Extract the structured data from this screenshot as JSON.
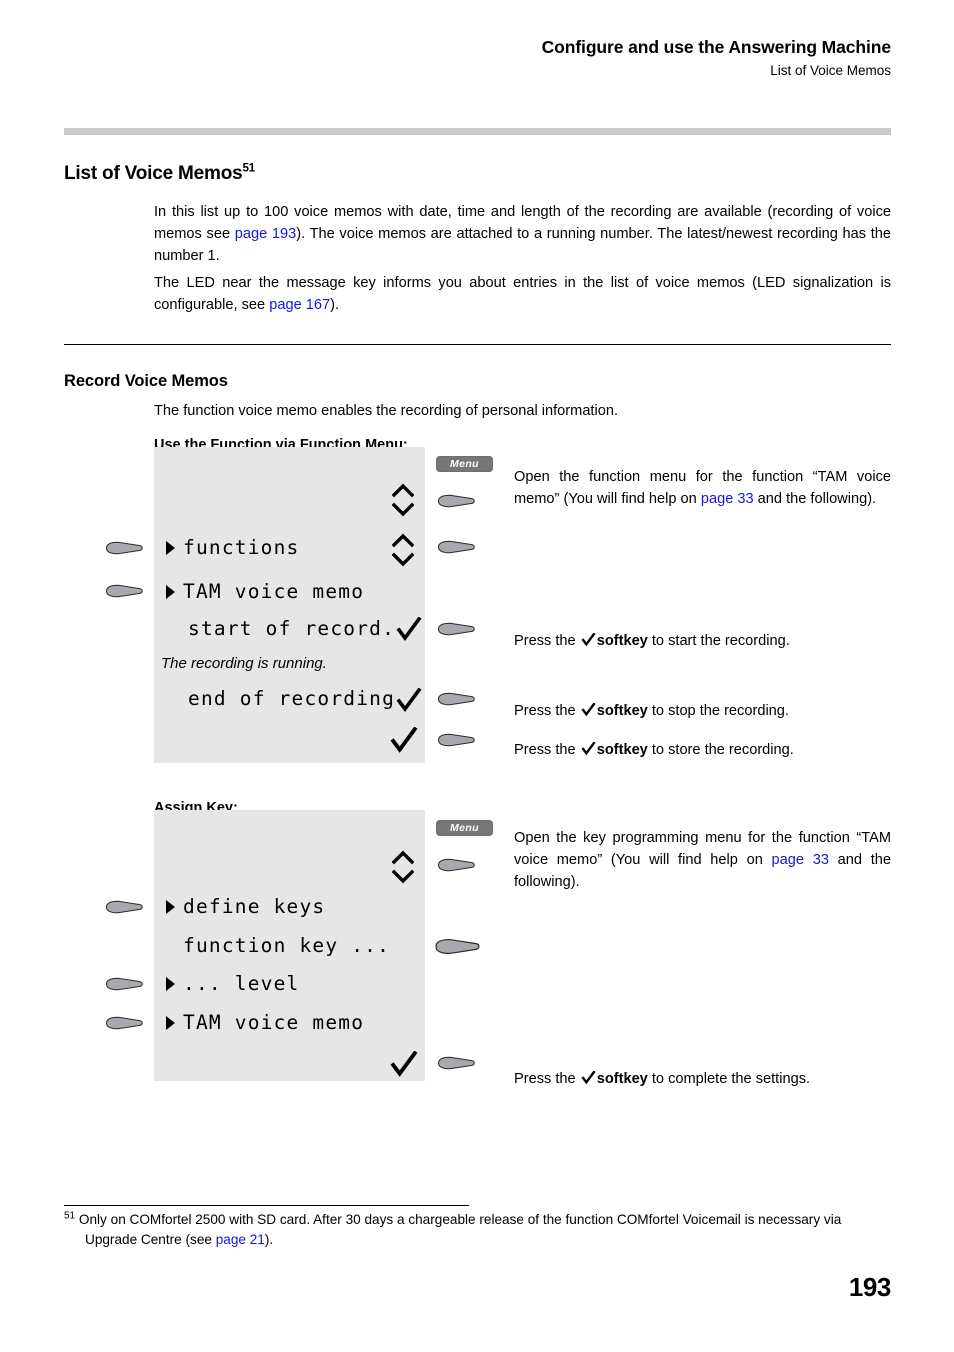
{
  "header": {
    "title": "Configure and use the Answering Machine",
    "subtitle": "List of Voice Memos"
  },
  "sections": {
    "list_of_voice_memos": {
      "heading": "List of Voice Memos",
      "heading_footnote_marker": "51",
      "paragraph_1_a": "In this list up to 100 voice memos with date, time and length of the recording are available (recording of voice memos see ",
      "paragraph_1_link": "page 193",
      "paragraph_1_b": "). The voice memos are attached to a running number. The latest/newest recording has the number 1.",
      "paragraph_2_a": "The LED near the message key informs you about entries in the list of voice memos (LED signalization is configurable, see ",
      "paragraph_2_link": "page 167",
      "paragraph_2_b": ")."
    },
    "record_voice_memos": {
      "heading": "Record Voice Memos",
      "intro": "The function voice memo enables the recording of personal information.",
      "subheading_function_menu": "Use the Function via Function Menu:",
      "subheading_assign_key": "Assign Key:"
    }
  },
  "diagram_function_menu": {
    "menu_key_label": "Menu",
    "lcd_lines": [
      "functions",
      "TAM voice memo",
      "start of record.",
      "end of recording"
    ],
    "lcd_status_italic": "The recording is running.",
    "instructions": [
      {
        "text_a": "Open the function menu for the function “TAM voice memo” (You will find help on ",
        "link": "page 33",
        "text_b": " and the following)."
      },
      {
        "text_a": "Press the ",
        "bold": "softkey",
        "text_b": " to start the recording."
      },
      {
        "text_a": "Press the ",
        "bold": "softkey",
        "text_b": " to stop the recording."
      },
      {
        "text_a": "Press the ",
        "bold": "softkey",
        "text_b": " to store the recording."
      }
    ]
  },
  "diagram_assign_key": {
    "menu_key_label": "Menu",
    "lcd_lines": [
      "define keys",
      "function key ...",
      "... level",
      "TAM voice memo"
    ],
    "instructions": [
      {
        "text_a": "Open the key programming menu for the function “TAM voice memo” (You will find help on ",
        "link": "page 33",
        "text_b": " and the following)."
      },
      {
        "text_a": "Press the ",
        "bold": "softkey",
        "text_b": " to complete the settings."
      }
    ]
  },
  "footnote": {
    "marker": "51",
    "text_a": "Only on COMfortel 2500 with SD card. After 30 days a chargeable release of the function COMfortel Voicemail is necessary via Upgrade Centre (see ",
    "link": "page 21",
    "text_b": ")."
  },
  "page_number": "193",
  "colors": {
    "link": "#1616e0",
    "lcd_background": "#e6e6e6",
    "softkey_fill": "#a8a8ae",
    "menu_key_fill": "#767676",
    "rule_gray": "#c9c9c9"
  }
}
